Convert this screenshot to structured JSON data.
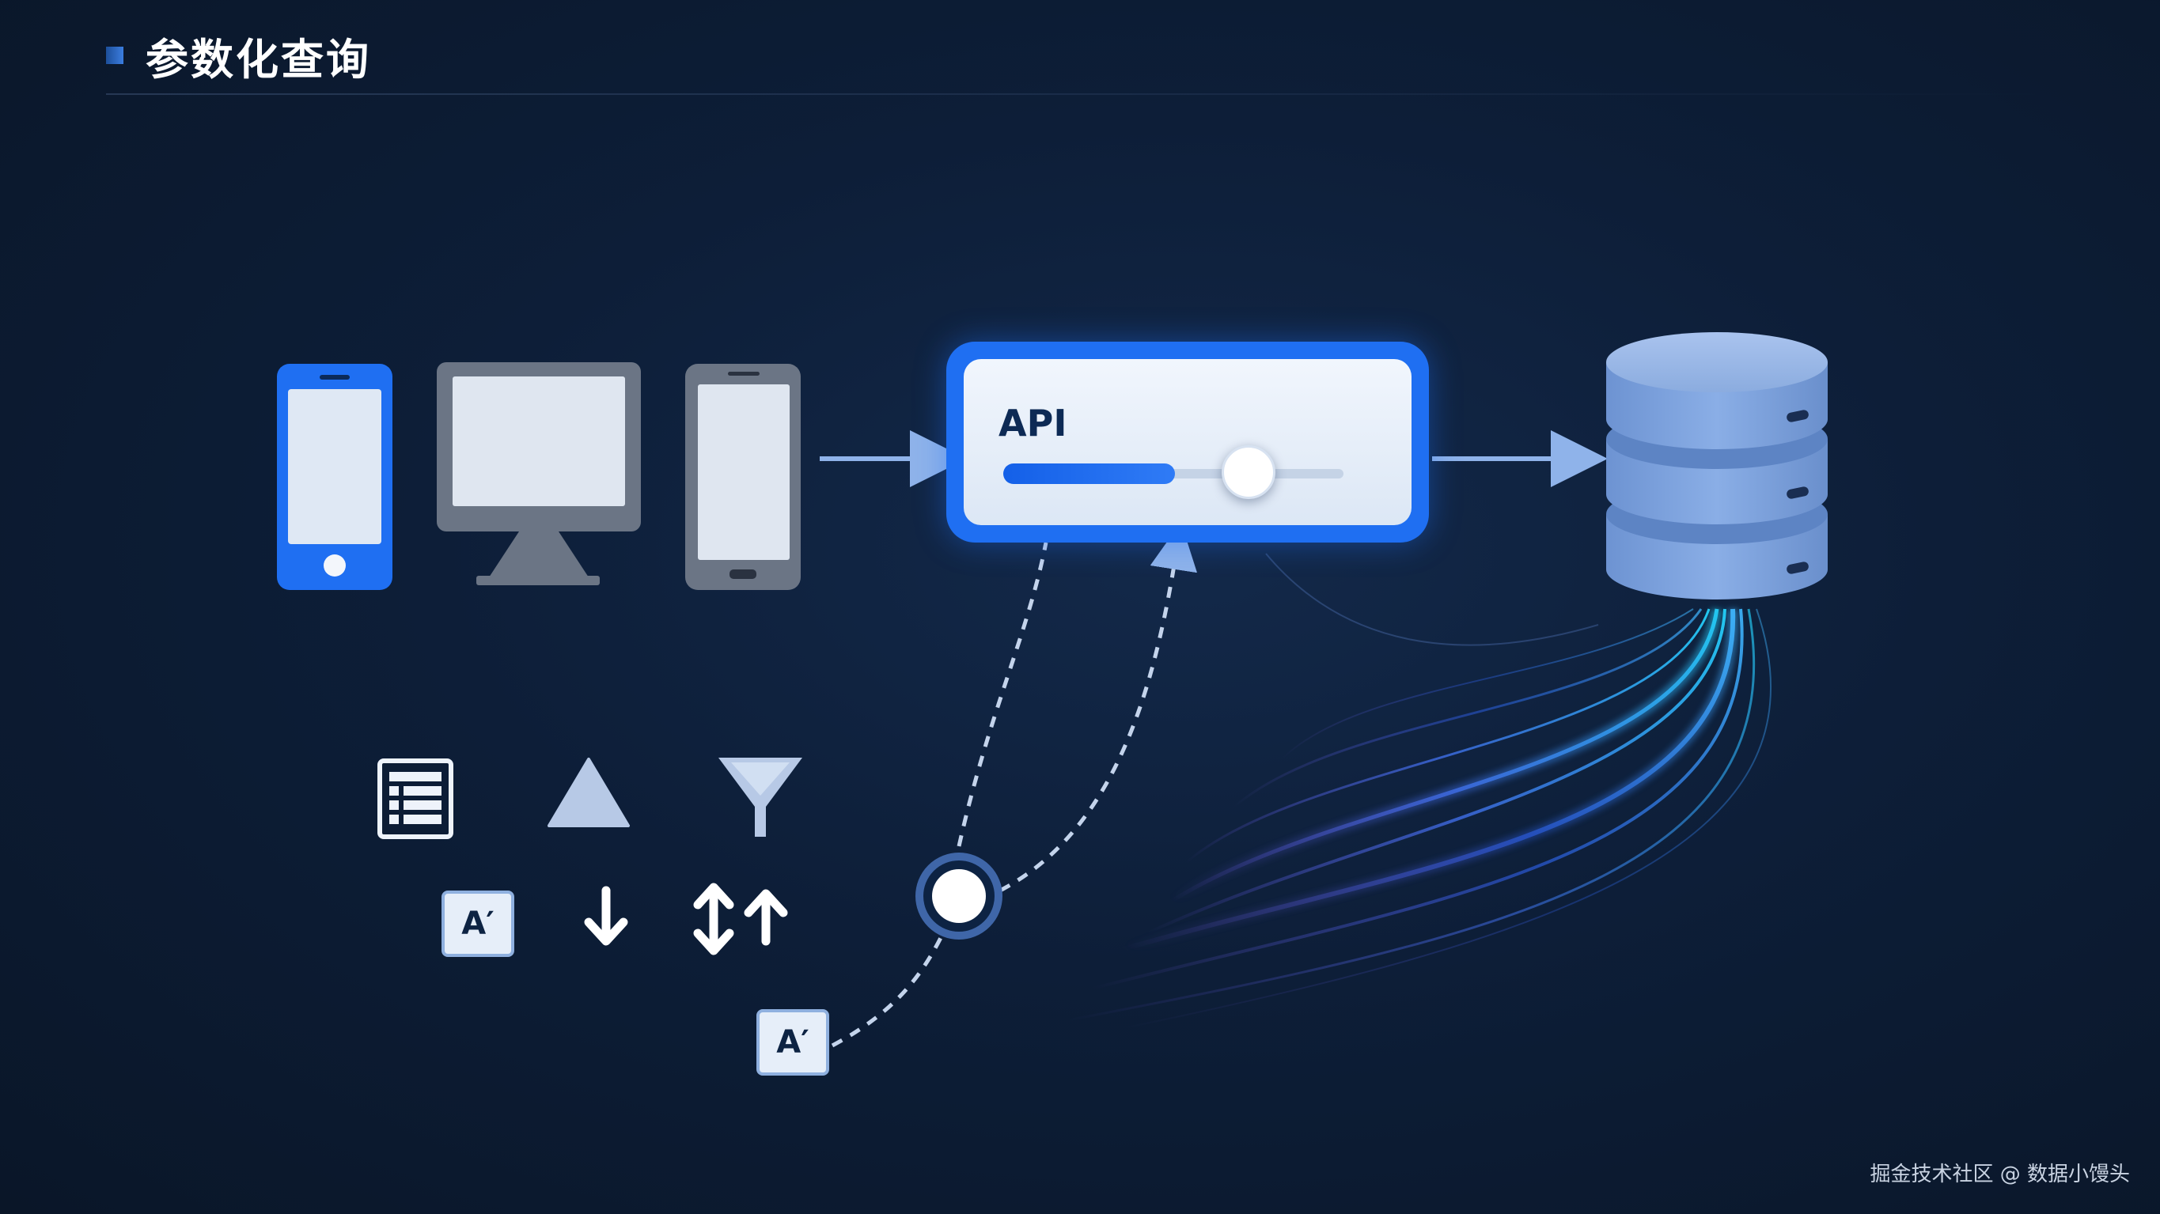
{
  "header": {
    "title": "参数化查询"
  },
  "clients": [
    {
      "icon": "smartphone-icon"
    },
    {
      "icon": "desktop-monitor-icon"
    },
    {
      "icon": "tablet-icon"
    }
  ],
  "api_box": {
    "label": "API",
    "slider_level": 0.72
  },
  "database": {
    "icon": "database-stack-icon"
  },
  "query_tools": [
    {
      "icon": "table-icon"
    },
    {
      "icon": "triangle-icon"
    },
    {
      "icon": "funnel-filter-icon"
    },
    {
      "icon": "parameter-chip-icon",
      "text": "A′"
    },
    {
      "icon": "sort-descending-icon"
    },
    {
      "icon": "sort-toggle-icon"
    }
  ],
  "parameter_input": {
    "text": "A′"
  },
  "watermark": "掘金技术社区 @ 数据小馒头",
  "colors": {
    "accent_blue": "#1f6ff2",
    "background": "#0d1e38",
    "db_blue": "#7da3dc",
    "stream_cyan": "#22c8f0",
    "stream_purple": "#6b4fd8"
  }
}
